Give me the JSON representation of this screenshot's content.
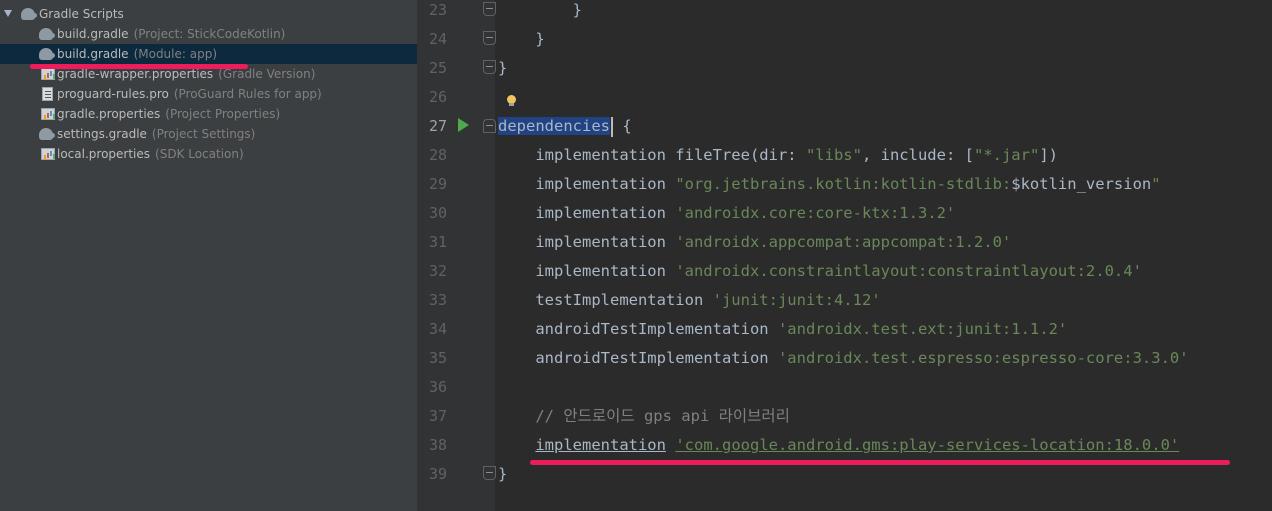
{
  "project_tree": {
    "root": {
      "label": "Gradle Scripts"
    },
    "items": [
      {
        "icon": "gradle-elephant-icon",
        "name": "build.gradle",
        "hint": "(Project: StickCodeKotlin)"
      },
      {
        "icon": "gradle-elephant-icon",
        "name": "build.gradle",
        "hint": "(Module: app)",
        "selected": true
      },
      {
        "icon": "properties-file-icon",
        "name": "gradle-wrapper.properties",
        "hint": "(Gradle Version)"
      },
      {
        "icon": "text-file-icon",
        "name": "proguard-rules.pro",
        "hint": "(ProGuard Rules for app)"
      },
      {
        "icon": "properties-file-icon",
        "name": "gradle.properties",
        "hint": "(Project Properties)"
      },
      {
        "icon": "gradle-elephant-icon",
        "name": "settings.gradle",
        "hint": "(Project Settings)"
      },
      {
        "icon": "properties-file-icon",
        "name": "local.properties",
        "hint": "(SDK Location)"
      }
    ]
  },
  "editor": {
    "lines": [
      {
        "n": "23",
        "code": "        }"
      },
      {
        "n": "24",
        "code": "    }"
      },
      {
        "n": "25",
        "code": "}"
      },
      {
        "n": "26",
        "code": ""
      },
      {
        "n": "27",
        "keyword": "dependencies",
        "rest": " {"
      },
      {
        "n": "28",
        "plain": "    implementation fileTree(",
        "named1": "dir: ",
        "str1": "\"libs\"",
        "mid": ", ",
        "named2": "include: ",
        "tail": "[",
        "str2": "\"*.jar\"",
        "end": "])"
      },
      {
        "n": "29",
        "plain": "    implementation ",
        "str": "\"org.jetbrains.kotlin:kotlin-stdlib:",
        "var": "$kotlin_version",
        "str_end": "\""
      },
      {
        "n": "30",
        "plain": "    implementation ",
        "str": "'androidx.core:core-ktx:1.3.2'"
      },
      {
        "n": "31",
        "plain": "    implementation ",
        "str": "'androidx.appcompat:appcompat:1.2.0'"
      },
      {
        "n": "32",
        "plain": "    implementation ",
        "str": "'androidx.constraintlayout:constraintlayout:2.0.4'"
      },
      {
        "n": "33",
        "plain": "    testImplementation ",
        "str": "'junit:junit:4.12'"
      },
      {
        "n": "34",
        "plain": "    androidTestImplementation ",
        "str": "'androidx.test.ext:junit:1.1.2'"
      },
      {
        "n": "35",
        "plain": "    androidTestImplementation ",
        "str": "'androidx.test.espresso:espresso-core:3.3.0'"
      },
      {
        "n": "36",
        "code": ""
      },
      {
        "n": "37",
        "comment": "    // 안드로이드 gps api 라이브러리"
      },
      {
        "n": "38",
        "plain": "    ",
        "kw": "implementation",
        "sp": " ",
        "str": "'com.google.android.gms:play-services-location:18.0.0'"
      },
      {
        "n": "39",
        "code": "}"
      }
    ]
  },
  "colors": {
    "highlight_underline": "#ee1c5a",
    "string": "#6a8759",
    "comment": "#808080",
    "code": "#a9b7c6",
    "selection": "#214283"
  }
}
